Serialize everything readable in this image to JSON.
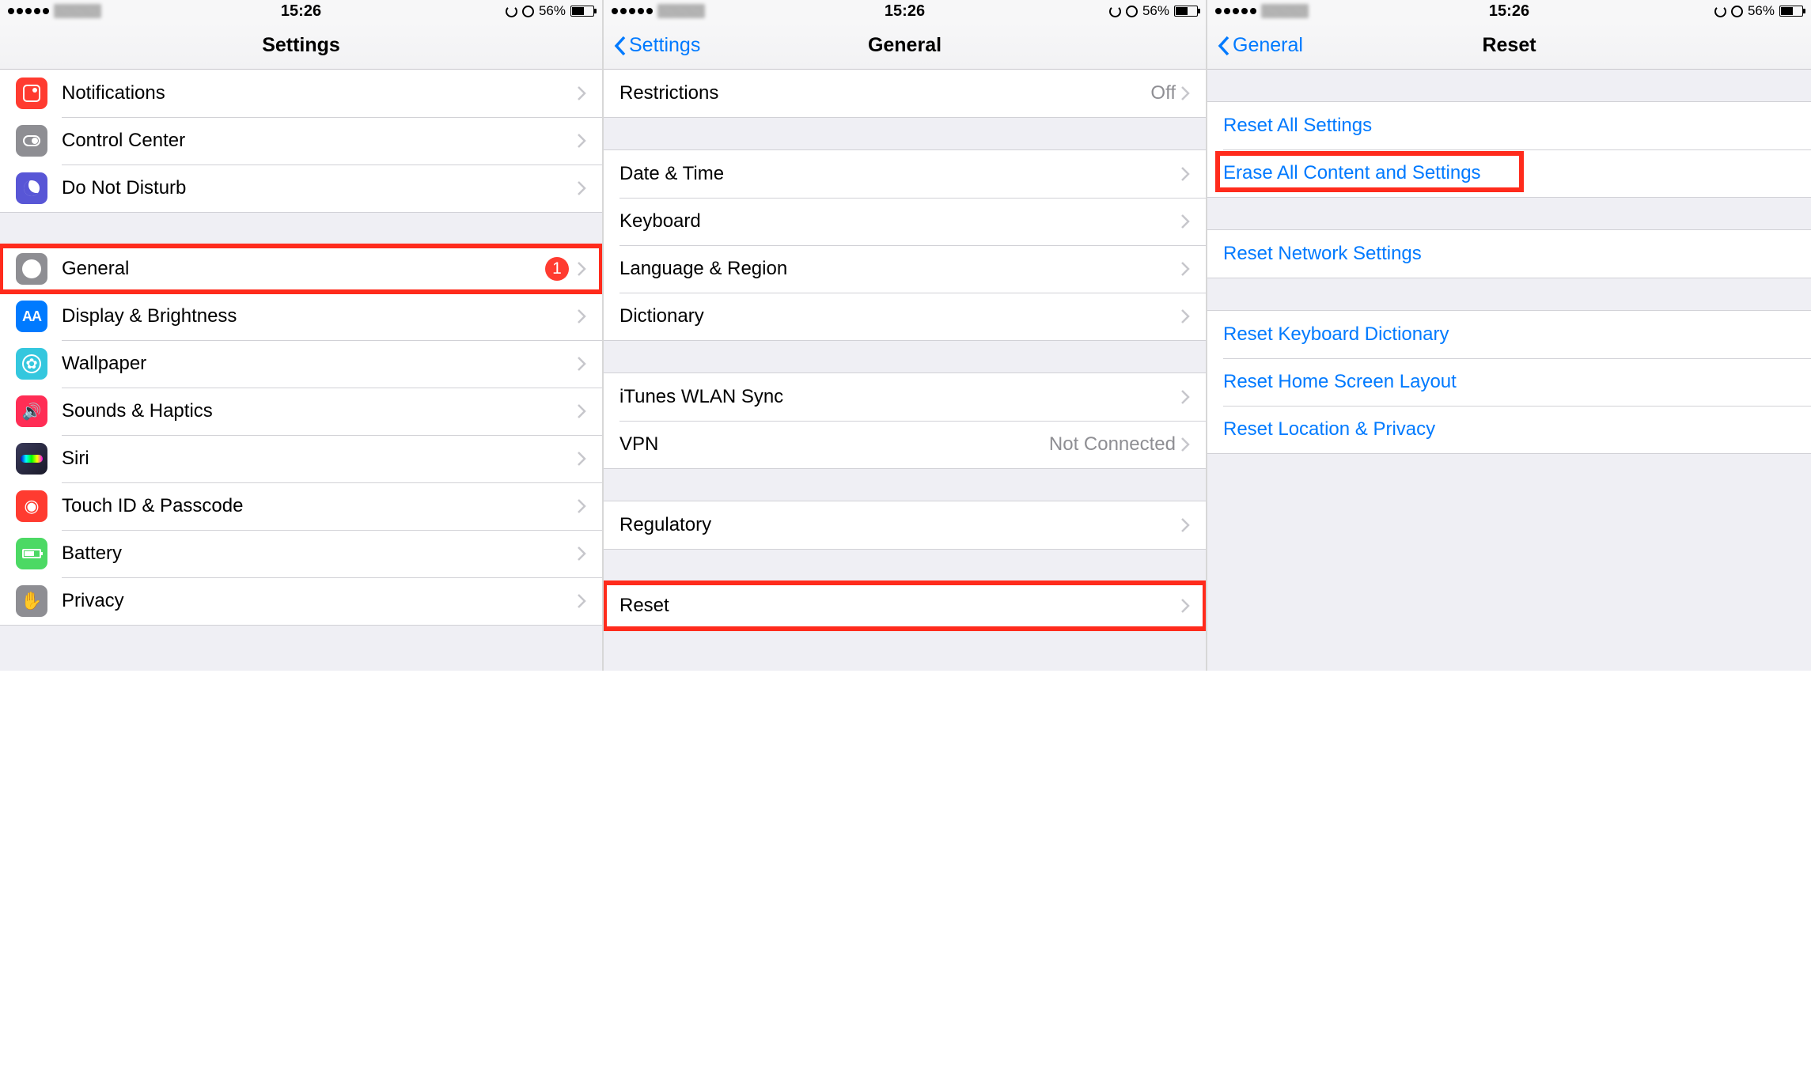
{
  "status": {
    "time": "15:26",
    "battery_pct": "56%"
  },
  "screen1": {
    "title": "Settings",
    "groups": [
      [
        {
          "icon": "notifications-icon",
          "label": "Notifications"
        },
        {
          "icon": "control-center-icon",
          "label": "Control Center"
        },
        {
          "icon": "dnd-icon",
          "label": "Do Not Disturb"
        }
      ],
      [
        {
          "icon": "general-icon",
          "label": "General",
          "badge": "1",
          "highlight": true
        },
        {
          "icon": "display-icon",
          "label": "Display & Brightness"
        },
        {
          "icon": "wallpaper-icon",
          "label": "Wallpaper"
        },
        {
          "icon": "sounds-icon",
          "label": "Sounds & Haptics"
        },
        {
          "icon": "siri-icon",
          "label": "Siri"
        },
        {
          "icon": "touchid-icon",
          "label": "Touch ID & Passcode"
        },
        {
          "icon": "battery-icon",
          "label": "Battery"
        },
        {
          "icon": "privacy-icon",
          "label": "Privacy"
        }
      ]
    ]
  },
  "screen2": {
    "back": "Settings",
    "title": "General",
    "groups": [
      [
        {
          "label": "Restrictions",
          "value": "Off"
        }
      ],
      [
        {
          "label": "Date & Time"
        },
        {
          "label": "Keyboard"
        },
        {
          "label": "Language & Region"
        },
        {
          "label": "Dictionary"
        }
      ],
      [
        {
          "label": "iTunes WLAN Sync"
        },
        {
          "label": "VPN",
          "value": "Not Connected"
        }
      ],
      [
        {
          "label": "Regulatory"
        }
      ],
      [
        {
          "label": "Reset",
          "highlight": true
        }
      ]
    ]
  },
  "screen3": {
    "back": "General",
    "title": "Reset",
    "groups": [
      [
        {
          "label": "Reset All Settings",
          "link": true
        },
        {
          "label": "Erase All Content and Settings",
          "link": true,
          "highlight_tight": true
        }
      ],
      [
        {
          "label": "Reset Network Settings",
          "link": true
        }
      ],
      [
        {
          "label": "Reset Keyboard Dictionary",
          "link": true
        },
        {
          "label": "Reset Home Screen Layout",
          "link": true
        },
        {
          "label": "Reset Location & Privacy",
          "link": true
        }
      ]
    ]
  }
}
